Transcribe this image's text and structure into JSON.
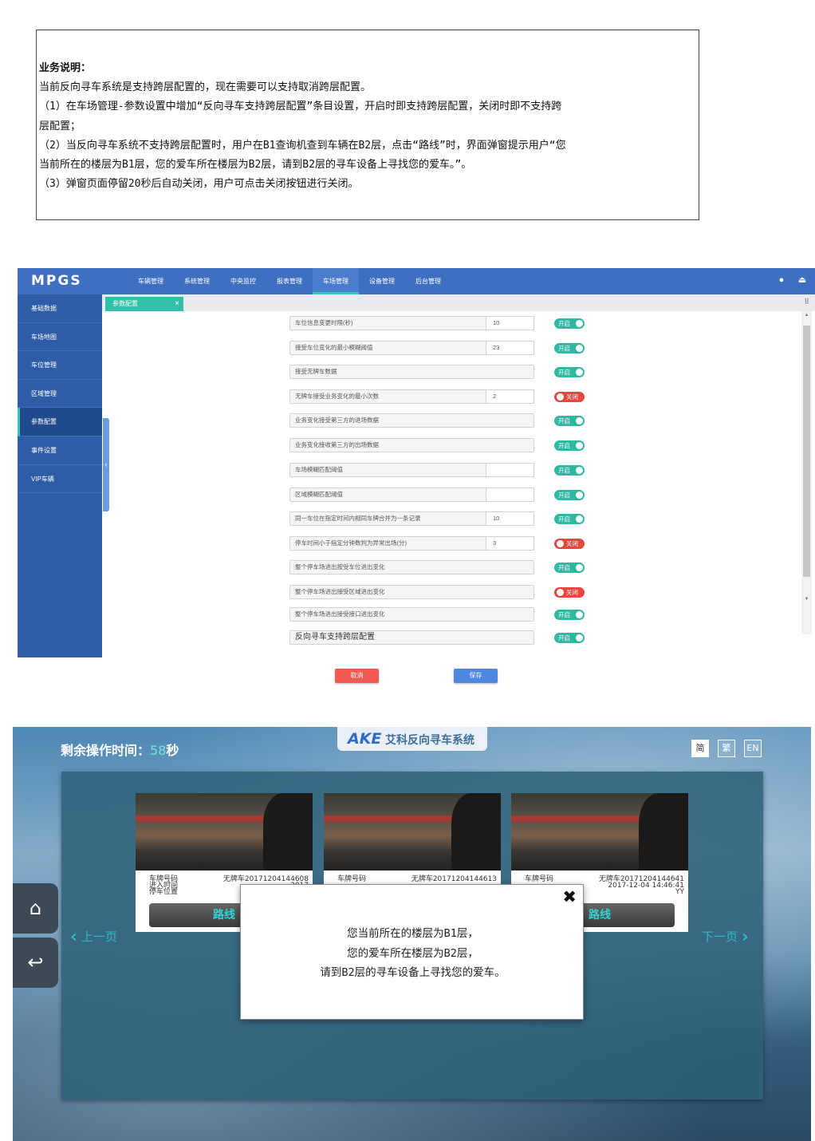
{
  "description": {
    "title": "业务说明：",
    "lines": [
      "当前反向寻车系统是支持跨层配置的，现在需要可以支持取消跨层配置。",
      "（1）在车场管理-参数设置中增加“反向寻车支持跨层配置”条目设置，开启时即支持跨层配置，关闭时即不支持跨",
      "层配置；",
      "（2）当反向寻车系统不支持跨层配置时，用户在B1查询机查到车辆在B2层，点击“路线”时，界面弹窗提示用户“您",
      "当前所在的楼层为B1层，您的爱车所在楼层为B2层，请到B2层的寻车设备上寻找您的爱车。”。",
      "（3）弹窗页面停留20秒后自动关闭，用户可点击关闭按钮进行关闭。"
    ]
  },
  "admin": {
    "logo": "MPGS",
    "nav": [
      "车辆管理",
      "系统管理",
      "中央监控",
      "报表管理",
      "车场管理",
      "设备管理",
      "后台管理"
    ],
    "nav_active_index": 4,
    "sidebar": [
      "基础数据",
      "车场地图",
      "车位管理",
      "区域管理",
      "参数配置",
      "事件设置",
      "VIP车辆"
    ],
    "sidebar_active_index": 4,
    "tab": {
      "label": "参数配置",
      "close": "×"
    },
    "rows": [
      {
        "label": "车位信息变更时限(秒)",
        "value": "10",
        "status": "开启"
      },
      {
        "label": "接受车位变化的最小模糊阈值",
        "value": "23",
        "status": "开启"
      },
      {
        "label": "接受无牌车数据",
        "value": null,
        "status": "开启"
      },
      {
        "label": "无牌车接受业务变化的最小次数",
        "value": "2",
        "status": "关闭"
      },
      {
        "label": "业务变化接受第三方的进场数据",
        "value": null,
        "status": "开启"
      },
      {
        "label": "业务变化接收第三方的出场数据",
        "value": null,
        "status": "开启"
      },
      {
        "label": "车场模糊匹配阈值",
        "value": "",
        "status": "开启"
      },
      {
        "label": "区域模糊匹配阈值",
        "value": "",
        "status": "开启"
      },
      {
        "label": "同一车位在指定时间内相同车牌合并为一条记录",
        "value": "10",
        "status": "开启"
      },
      {
        "label": "停车时间小于指定分钟数判为异常出场(分)",
        "value": "3",
        "status": "关闭"
      },
      {
        "label": "整个停车场进出按受车位进出变化",
        "value": null,
        "status": "开启"
      },
      {
        "label": "整个停车场进出接受区域进出变化",
        "value": null,
        "status": "关闭"
      },
      {
        "label": "整个停车场进出接受接口进出变化",
        "value": null,
        "status": "开启"
      },
      {
        "label": "反向寻车支持跨层配置",
        "value": null,
        "status": "开启"
      }
    ],
    "cancel_label": "取消",
    "save_label": "保存",
    "handle_glyph": "‹",
    "grid_glyph": "⠿"
  },
  "kiosk": {
    "timer_label": "剩余操作时间：",
    "timer_seconds": "58",
    "timer_unit": "秒",
    "brand_logo": "AKE",
    "brand_name": "艾科反向寻车系统",
    "langs": [
      "简",
      "繁",
      "EN"
    ],
    "cards": [
      {
        "plate_label": "车牌号码",
        "plate": "无牌车201712041446​08",
        "time_label": "进入时间",
        "time": "2017",
        "pos_label": "停车位置",
        "pos": ""
      },
      {
        "plate_label": "车牌号码",
        "plate": "无牌车201712041446​13",
        "time_label": "",
        "time": "",
        "pos_label": "",
        "pos": ""
      },
      {
        "plate_label": "车牌号码",
        "plate": "无牌车201712041446​41",
        "time_label": "",
        "time": "2017-12-04 14:46:41",
        "pos_label": "",
        "pos": "YY"
      }
    ],
    "route_label": "路线",
    "prev_label": "上一页",
    "next_label": "下一页",
    "modal": {
      "line1": "您当前所在的楼层为B1层，",
      "line2": "您的爱车所在楼层为B2层，",
      "line3": "请到B2层的寻车设备上寻找您的爱车。",
      "close": "✖"
    }
  }
}
